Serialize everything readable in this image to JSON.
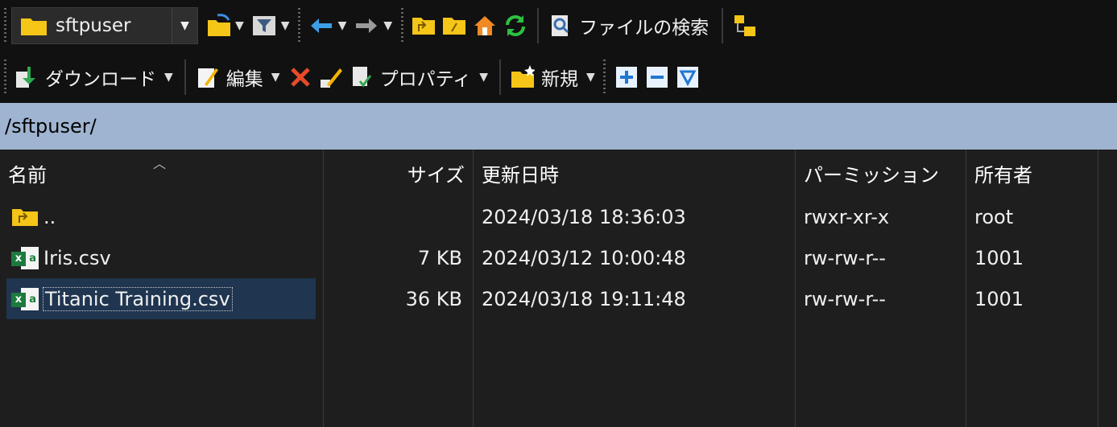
{
  "toolbar1": {
    "location": "sftpuser",
    "find_files_label": "ファイルの検索"
  },
  "toolbar2": {
    "download_label": "ダウンロード",
    "edit_label": "編集",
    "properties_label": "プロパティ",
    "new_label": "新規"
  },
  "address": "/sftpuser/",
  "columns": {
    "name": "名前",
    "size": "サイズ",
    "modified": "更新日時",
    "permissions": "パーミッション",
    "owner": "所有者"
  },
  "rows": [
    {
      "name": "..",
      "size": "",
      "modified": "2024/03/18 18:36:03",
      "permissions": "rwxr-xr-x",
      "owner": "root"
    },
    {
      "name": "Iris.csv",
      "size": "7 KB",
      "modified": "2024/03/12 10:00:48",
      "permissions": "rw-rw-r--",
      "owner": "1001"
    },
    {
      "name": "Titanic Training.csv",
      "size": "36 KB",
      "modified": "2024/03/18 19:11:48",
      "permissions": "rw-rw-r--",
      "owner": "1001"
    }
  ],
  "colors": {
    "address_bg": "#9fb4d0",
    "selection_bg": "#1f3550",
    "folder": "#f5c518",
    "excel_green": "#1d7a3e"
  }
}
